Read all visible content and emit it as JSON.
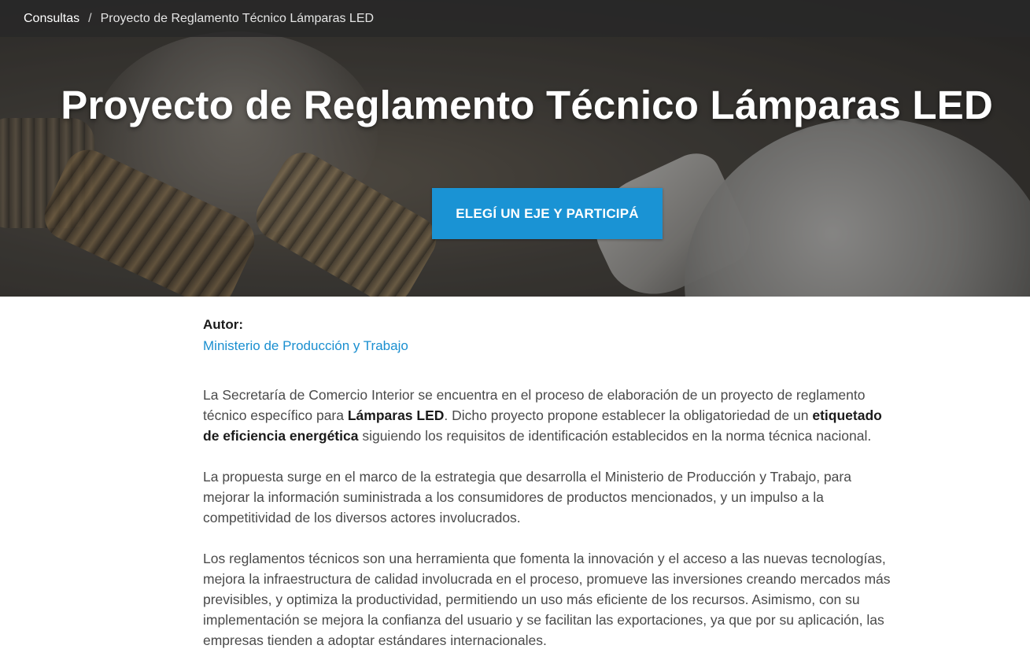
{
  "breadcrumb": {
    "root": "Consultas",
    "separator": "/",
    "current": "Proyecto de Reglamento Técnico Lámparas LED"
  },
  "hero": {
    "title": "Proyecto de Reglamento Técnico Lámparas LED",
    "cta_label": "ELEGÍ UN EJE Y PARTICIPÁ"
  },
  "author": {
    "label": "Autor:",
    "name": "Ministerio de Producción y Trabajo"
  },
  "body": {
    "p1": {
      "a": "La Secretaría de Comercio Interior se encuentra en el proceso de elaboración de un proyecto de reglamento técnico específico para ",
      "b": "Lámparas LED",
      "c": ". Dicho proyecto propone establecer la obligatoriedad de un ",
      "d": "etiquetado de eficiencia energética",
      "e": " siguiendo los requisitos de identificación establecidos en la norma técnica nacional."
    },
    "p2": "La propuesta surge en el marco de la estrategia que desarrolla el Ministerio de Producción y Trabajo, para mejorar la información suministrada a los consumidores de productos mencionados, y un impulso a la competitividad de los diversos actores involucrados.",
    "p3": "Los reglamentos técnicos son una herramienta que fomenta la innovación y el acceso a las nuevas tecnologías, mejora la infraestructura de calidad involucrada en el proceso, promueve las inversiones creando mercados más previsibles, y optimiza la productividad, permitiendo un uso más eficiente de los recursos. Asimismo, con su implementación se mejora la confianza del usuario y se facilitan las exportaciones, ya que por su aplicación, las empresas tienden a adoptar estándares internacionales."
  },
  "colors": {
    "accent": "#1a93d4",
    "link": "#1a8fd0",
    "breadcrumb_bar": "#282828",
    "body_text": "#4a4a4a"
  }
}
